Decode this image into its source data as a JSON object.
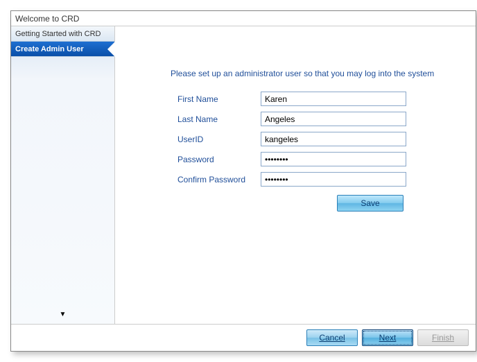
{
  "window": {
    "title": "Welcome to CRD"
  },
  "sidebar": {
    "items": [
      {
        "label": "Getting Started with CRD"
      },
      {
        "label": "Create Admin User"
      }
    ]
  },
  "main": {
    "instruction": "Please set up an administrator user so that you may log into the system",
    "labels": {
      "first_name": "First Name",
      "last_name": "Last Name",
      "user_id": "UserID",
      "password": "Password",
      "confirm_password": "Confirm Password"
    },
    "values": {
      "first_name": "Karen",
      "last_name": "Angeles",
      "user_id": "kangeles",
      "password": "••••••••",
      "confirm_password": "••••••••"
    },
    "save_label": "Save"
  },
  "footer": {
    "cancel": "Cancel",
    "next": "Next",
    "finish": "Finish"
  }
}
